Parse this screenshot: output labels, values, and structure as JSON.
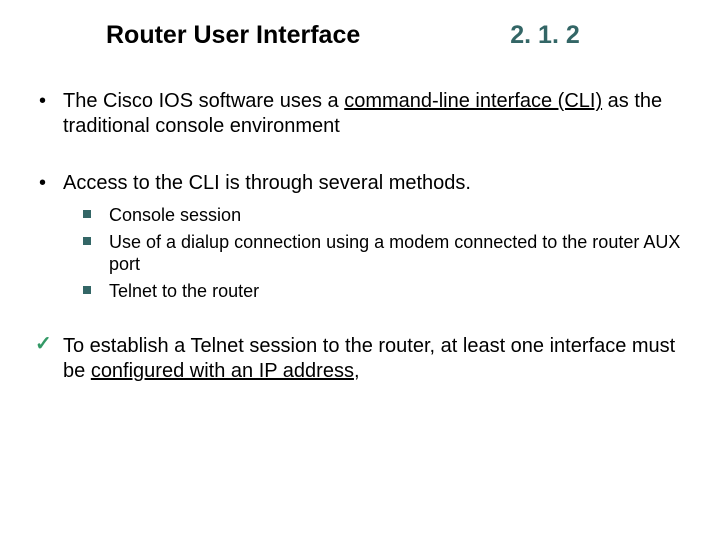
{
  "header": {
    "title": "Router User Interface",
    "section_number": "2. 1. 2"
  },
  "bullets": {
    "b1_a": "The Cisco IOS software uses a ",
    "b1_u": "command-line interface (CLI)",
    "b1_b": " as the traditional console environment",
    "b2": "Access to the CLI is through several methods.",
    "sub1": "Console session",
    "sub2": "Use of a dialup connection using a modem connected to the router AUX port",
    "sub3": "Telnet to the router",
    "b3_a": "To establish a Telnet session to the router, at least one interface must be ",
    "b3_u": "configured with an IP address",
    "b3_b": ","
  }
}
